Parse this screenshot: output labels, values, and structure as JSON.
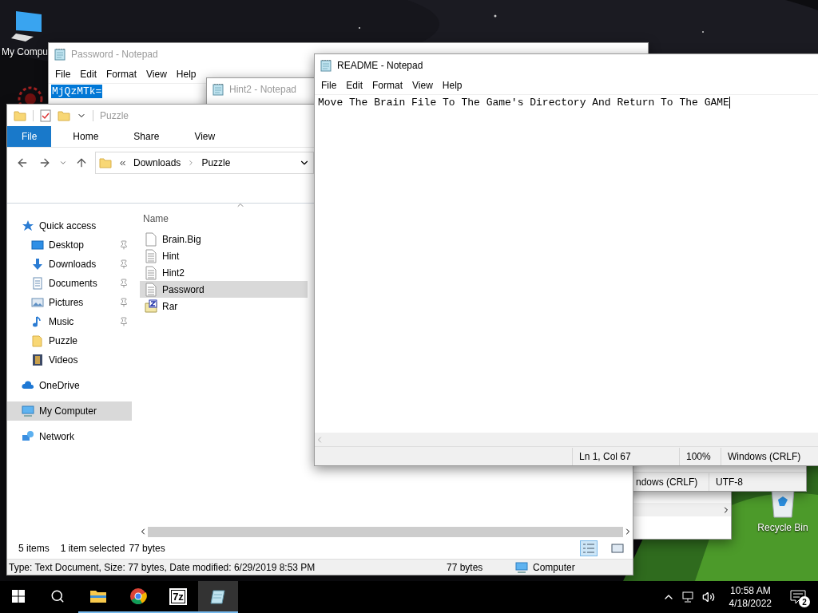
{
  "desktop": {
    "icons": [
      {
        "kind": "computer",
        "label": "My Compu"
      },
      {
        "kind": "app"
      },
      {
        "kind": "recycle",
        "label": "Recycle Bin"
      }
    ]
  },
  "password_notepad": {
    "title": "Password - Notepad",
    "menu": [
      "File",
      "Edit",
      "Format",
      "View",
      "Help"
    ],
    "lines": [
      {
        "text": "MjQzMTk=",
        "selected": true
      }
    ]
  },
  "hint2_notepad": {
    "title": "Hint2 - Notepad",
    "status": [
      "ndows (CRLF)",
      "UTF-8"
    ]
  },
  "explorer": {
    "title": "Puzzle",
    "ribbon_tabs": [
      {
        "label": "File",
        "selected": true
      },
      {
        "label": "Home",
        "selected": false
      },
      {
        "label": "Share",
        "selected": false
      },
      {
        "label": "View",
        "selected": false
      }
    ],
    "address": [
      "Downloads",
      "Puzzle"
    ],
    "nav": [
      {
        "label": "Quick access",
        "kind": "star",
        "selected": false,
        "children": [
          {
            "label": "Desktop",
            "kind": "desktop",
            "pinned": true,
            "selected": false
          },
          {
            "label": "Downloads",
            "kind": "download",
            "pinned": true,
            "selected": false
          },
          {
            "label": "Documents",
            "kind": "document",
            "pinned": true,
            "selected": false
          },
          {
            "label": "Pictures",
            "kind": "pictures",
            "pinned": true,
            "selected": false
          },
          {
            "label": "Music",
            "kind": "music",
            "pinned": true,
            "selected": false
          },
          {
            "label": "Puzzle",
            "kind": "folder",
            "pinned": false,
            "selected": false
          },
          {
            "label": "Videos",
            "kind": "video",
            "pinned": false,
            "selected": false
          }
        ]
      },
      {
        "label": "OneDrive",
        "kind": "cloud",
        "selected": false
      },
      {
        "label": "My Computer",
        "kind": "computer",
        "selected": true
      },
      {
        "label": "Network",
        "kind": "network",
        "selected": false
      }
    ],
    "column": "Name",
    "files": [
      {
        "name": "Brain.Big",
        "kind": "blank",
        "selected": false
      },
      {
        "name": "Hint",
        "kind": "text",
        "selected": false
      },
      {
        "name": "Hint2",
        "kind": "text",
        "selected": false
      },
      {
        "name": "Password",
        "kind": "text",
        "selected": true
      },
      {
        "name": "Rar",
        "kind": "archive",
        "selected": false
      }
    ],
    "status": [
      "5 items",
      "1 item selected",
      "77 bytes"
    ],
    "details": {
      "info": "Type: Text Document, Size: 77 bytes, Date modified: 6/29/2019 8:53 PM",
      "size": "77 bytes",
      "location": "Computer"
    }
  },
  "readme_notepad": {
    "title": "README - Notepad",
    "menu": [
      "File",
      "Edit",
      "Format",
      "View",
      "Help"
    ],
    "text": "Move The Brain File To The Game's Directory And Return To The GAME",
    "status": [
      "Ln 1, Col 67",
      "100%",
      "Windows (CRLF)"
    ]
  },
  "taskbar": {
    "apps": [
      {
        "kind": "explorer",
        "active": false
      },
      {
        "kind": "chrome",
        "active": false
      },
      {
        "kind": "sevenzip",
        "logo": "7z",
        "active": false
      },
      {
        "kind": "notepad",
        "active": true
      }
    ],
    "time": "10:58 AM",
    "date": "4/18/2022",
    "notifications": "2"
  }
}
